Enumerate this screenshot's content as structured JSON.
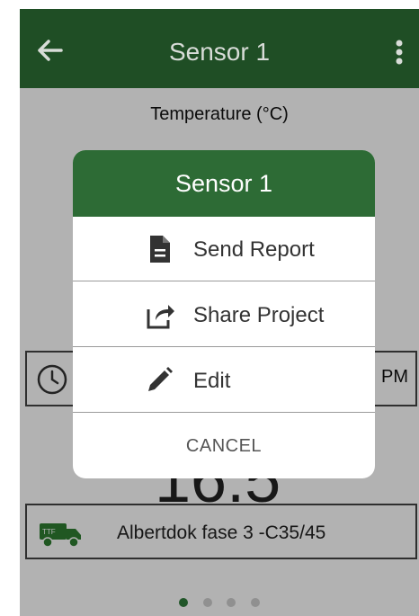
{
  "appbar": {
    "title": "Sensor 1",
    "back_icon": "arrow-left-icon",
    "menu_icon": "more-vert-icon",
    "color": "#1f4e25"
  },
  "content": {
    "metric_label": "Temperature (°C)",
    "time_suffix": "PM",
    "big_value": "16.5",
    "project_name": "Albertdok fase 3 -C35/45",
    "truck_badge": "TTF",
    "page_indicator": {
      "count": 4,
      "active": 1
    }
  },
  "dialog": {
    "title": "Sensor 1",
    "header_color": "#2d6b35",
    "items": [
      {
        "label": "Send Report",
        "icon": "document-icon"
      },
      {
        "label": "Share Project",
        "icon": "share-icon"
      },
      {
        "label": "Edit",
        "icon": "pencil-icon"
      }
    ],
    "cancel_label": "CANCEL"
  }
}
